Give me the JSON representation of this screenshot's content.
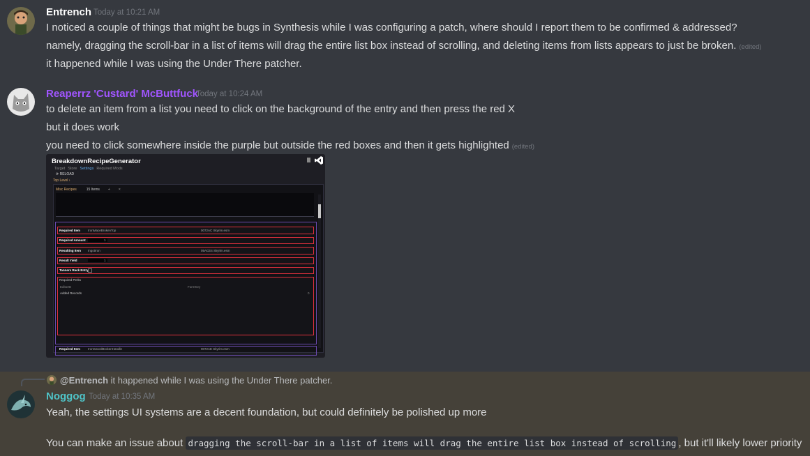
{
  "messages": [
    {
      "author": "Entrench",
      "author_color": "#ffffff",
      "timestamp": "Today at 10:21 AM",
      "lines": [
        "I noticed a couple of things that might be bugs in Synthesis while I was configuring a patch, where should I report them to be confirmed & addressed?",
        "namely, dragging the scroll-bar in a list of items will drag the entire list box instead of scrolling, and deleting items from lists appears to just be broken.",
        "it happened while I was using the Under There patcher."
      ],
      "edited_label": "(edited)"
    },
    {
      "author": "Reaperrz 'Custard' McButtfuck",
      "author_color": "#a155ff",
      "timestamp": "Today at 10:24 AM",
      "lines": [
        "to delete an item from a list you need to click on the background of the entry and then press the red X",
        "but it does work",
        "you need to click somewhere inside the purple but outside the red boxes and then it gets highlighted"
      ],
      "edited_label": "(edited)"
    },
    {
      "author": "Noggog",
      "author_color": "#4fc3c7",
      "timestamp": "Today at 10:35 AM",
      "reply": {
        "mention": "@Entrench",
        "text": "it happened while I was using the Under There patcher."
      },
      "lines": [
        "Yeah, the settings UI systems are a decent foundation, but could definitely be polished up more"
      ],
      "issue_line": {
        "prefix": "You can make an issue about",
        "code": "dragging the scroll-bar in a list of items will drag the entire list box instead of scrolling",
        "suffix": ", but it'll likely lower priority"
      }
    }
  ],
  "screenshot": {
    "title": "BreakdownRecipeGenerator",
    "tabs": [
      "Target",
      "Store",
      "Settings",
      "Required Mods"
    ],
    "active_tab": "Settings",
    "reload": "RELOAD",
    "top_level": "Top Level",
    "list_name": "Misc Recipes",
    "item_count": "15 Items",
    "plus": "+",
    "x": "×",
    "fields": {
      "required_item_label": "Required Item",
      "required_item_value": "IronMaceBrokenTop",
      "required_item_file": "0072AC Skyrim.esm",
      "required_amount_label": "Required Amount",
      "required_amount_value": "1",
      "resulting_item_label": "Resulting Item",
      "resulting_item_value": "IngotIron",
      "resulting_item_file": "05ACE4 Skyrim.esm",
      "result_yield_label": "Result Yield",
      "result_yield_value": "1",
      "tanners_rack_label": "Tanners Rack Entry",
      "required_perks_label": "Required Perks",
      "editor_id_label": "EditorID",
      "form_key_label": "FormKey",
      "added_records_label": "Added Records",
      "added_records_count": "0",
      "next_item_label": "Required Item",
      "next_item_value": "IronSwordBrokenHandle",
      "next_item_file": "0072AE Skyrim.esm"
    }
  }
}
